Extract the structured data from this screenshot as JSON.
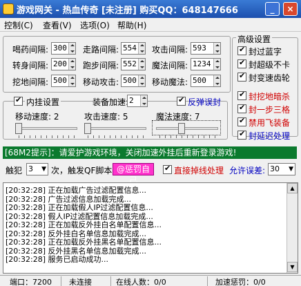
{
  "window": {
    "title": "游戏网关 - 热血传奇 [未注册] 购买QQ：648147666",
    "minimize_glyph": "_",
    "close_glyph": "×"
  },
  "menu": {
    "items": [
      "控制(C)",
      "查看(V)",
      "选项(O)",
      "帮助(H)"
    ]
  },
  "intervals": {
    "drink": {
      "label": "喝药间隔:",
      "value": "300"
    },
    "walk": {
      "label": "走路间隔:",
      "value": "554"
    },
    "attack": {
      "label": "攻击间隔:",
      "value": "593"
    },
    "turn": {
      "label": "转身间隔:",
      "value": "200"
    },
    "run": {
      "label": "跑步间隔:",
      "value": "552"
    },
    "magic": {
      "label": "魔法间隔:",
      "value": "1234"
    },
    "dig": {
      "label": "挖地间隔:",
      "value": "500"
    },
    "move_attack": {
      "label": "移动攻击:",
      "value": "500"
    },
    "move_magic": {
      "label": "移动魔法:",
      "value": "500"
    }
  },
  "advanced": {
    "legend": "高级设置",
    "items": [
      {
        "label": "封过蓝字",
        "color": "#000000",
        "checked": true
      },
      {
        "label": "封超级不卡",
        "color": "#000000",
        "checked": true
      },
      {
        "label": "封变速齿轮",
        "color": "#000000",
        "checked": true
      },
      {
        "label": "封挖地暗杀",
        "color": "#d00000",
        "checked": true
      },
      {
        "label": "封一步三格",
        "color": "#d00000",
        "checked": true
      },
      {
        "label": "禁用飞装备",
        "color": "#d00000",
        "checked": true
      },
      {
        "label": "封延迟处理",
        "color": "#0000c0",
        "checked": true
      }
    ]
  },
  "plugin": {
    "label": "内挂设置",
    "checked": true,
    "gear_label": "装备加速:+",
    "gear_value": "2",
    "anti_miss_label": "反弹误封",
    "anti_miss_checked": true,
    "move_speed_label": "移动速度: 2",
    "attack_speed_label": "攻击速度: 5",
    "magic_speed_label": "魔法速度: 7",
    "move_speed": 2,
    "attack_speed": 5,
    "magic_speed": 7,
    "speed_max": 10
  },
  "notice": "[68M2提示]：请爱护游戏环境，关闭加速外挂后重新登录游戏!",
  "trigger": {
    "prefix": "触犯",
    "count": "3",
    "suffix": "次，触发QF脚本",
    "script_button": "@惩罚自己",
    "drop_label": "直接掉线处理",
    "drop_checked": true,
    "tolerance_label": "允许误差:",
    "tolerance_value": "30"
  },
  "log": [
    "[20:32:28] 正在加载广告过滤配置信息...",
    "[20:32:28] 广告过滤信息加载完成...",
    "[20:32:28] 正在加载假人IP过滤配置信息...",
    "[20:32:28] 假人IP过滤配置信息加载完成...",
    "[20:32:28] 正在加载反外挂白名单配置信息...",
    "[20:32:28] 反外挂白名单信息加载完成...",
    "[20:32:28] 正在加载反外挂黑名单配置信息...",
    "[20:32:28] 反外挂黑名单信息加载完成...",
    "[20:32:28] 服务已启动成功..."
  ],
  "status": {
    "port": "端口：7200",
    "connection": "未连接",
    "online": "在线人数：0/0",
    "penalty": "加速惩罚：0/0"
  }
}
